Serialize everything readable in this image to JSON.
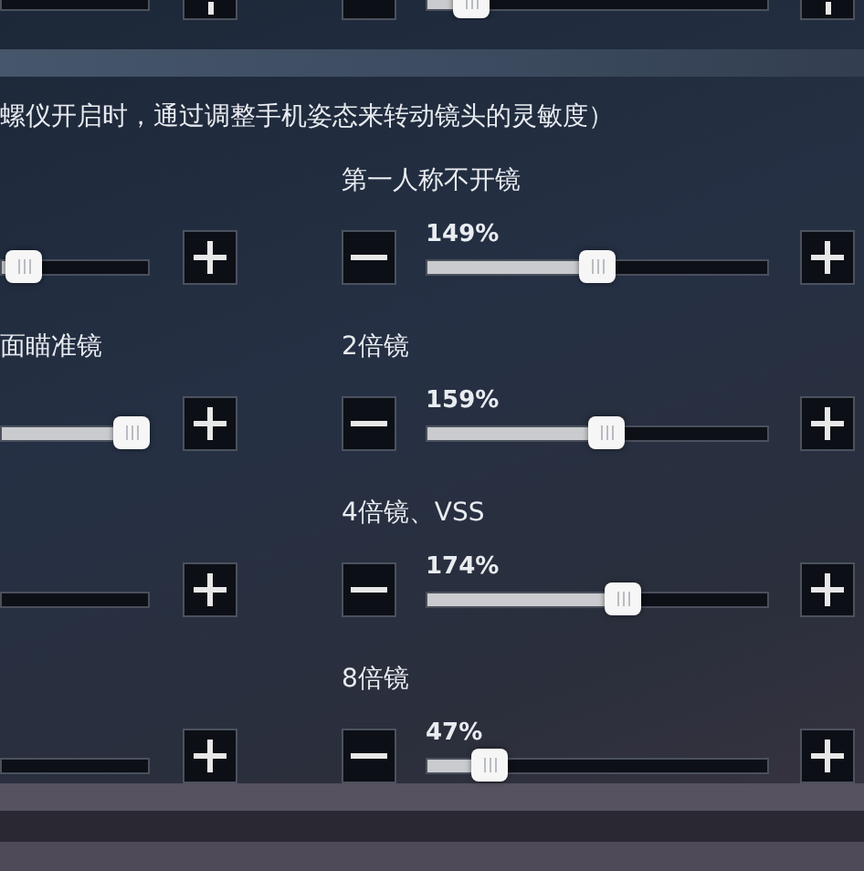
{
  "top_row": {
    "left": {
      "level": 0
    },
    "right": {
      "level": 0.09
    }
  },
  "description": "螺仪开启时，通过调整手机姿态来转动镜头的灵敏度）",
  "left_column": [
    {
      "level": 0.05
    },
    {
      "label": "面瞄准镜",
      "level": 1
    },
    {
      "level": 0
    },
    {
      "level": 0
    }
  ],
  "right_column": [
    {
      "label": "第一人称不开镜",
      "reading": "149%",
      "level": 0.5
    },
    {
      "label": "2倍镜",
      "reading": "159%",
      "level": 0.53
    },
    {
      "label": "4倍镜、VSS",
      "reading": "174%",
      "level": 0.585
    },
    {
      "label": "8倍镜",
      "reading": "47%",
      "level": 0.15
    }
  ]
}
